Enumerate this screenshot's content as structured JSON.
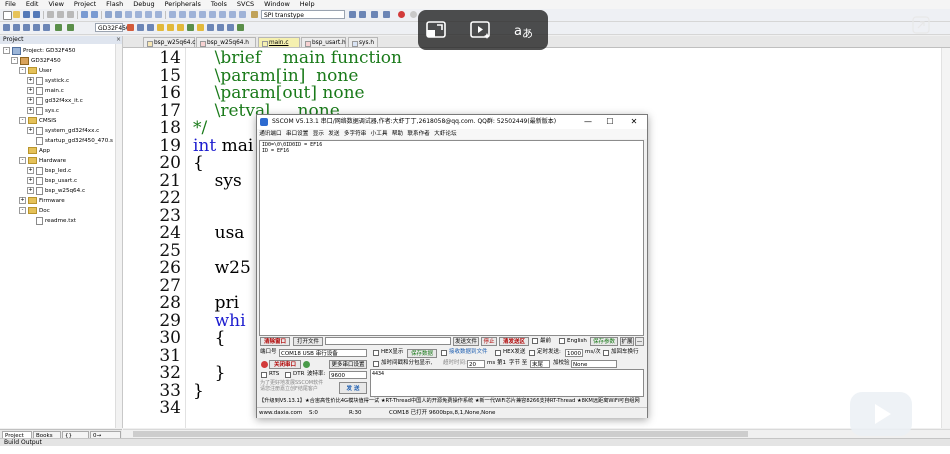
{
  "menubar": [
    "File",
    "Edit",
    "View",
    "Project",
    "Flash",
    "Debug",
    "Peripherals",
    "Tools",
    "SVCS",
    "Window",
    "Help"
  ],
  "toolbar": {
    "device_combo": "SPI transtype",
    "target_combo": "GD32F450"
  },
  "project_panel": {
    "header": "Project",
    "tree": [
      {
        "level": 0,
        "kind": "project",
        "label": "Project: GD32F450",
        "exp": "-"
      },
      {
        "level": 1,
        "kind": "target",
        "label": "GD32F450",
        "exp": "-"
      },
      {
        "level": 2,
        "kind": "folder",
        "label": "User",
        "exp": "-"
      },
      {
        "level": 3,
        "kind": "file",
        "label": "systick.c",
        "exp": "+"
      },
      {
        "level": 3,
        "kind": "file",
        "label": "main.c",
        "exp": "+"
      },
      {
        "level": 3,
        "kind": "file",
        "label": "gd32f4xx_it.c",
        "exp": "+"
      },
      {
        "level": 3,
        "kind": "file",
        "label": "sys.c",
        "exp": "+"
      },
      {
        "level": 2,
        "kind": "folder",
        "label": "CMSIS",
        "exp": "-"
      },
      {
        "level": 3,
        "kind": "file",
        "label": "system_gd32f4xx.c",
        "exp": "+"
      },
      {
        "level": 3,
        "kind": "file",
        "label": "startup_gd32f450_470.s",
        "exp": ""
      },
      {
        "level": 2,
        "kind": "folder",
        "label": "App",
        "exp": ""
      },
      {
        "level": 2,
        "kind": "folder",
        "label": "Hardware",
        "exp": "-"
      },
      {
        "level": 3,
        "kind": "file",
        "label": "bsp_led.c",
        "exp": "+"
      },
      {
        "level": 3,
        "kind": "file",
        "label": "bsp_usart.c",
        "exp": "+"
      },
      {
        "level": 3,
        "kind": "file",
        "label": "bsp_w25q64.c",
        "exp": "+"
      },
      {
        "level": 2,
        "kind": "folder",
        "label": "Firmware",
        "exp": "+"
      },
      {
        "level": 2,
        "kind": "folder",
        "label": "Doc",
        "exp": "-"
      },
      {
        "level": 3,
        "kind": "file",
        "label": "readme.txt",
        "exp": ""
      }
    ],
    "tabs": [
      "Project",
      "Books",
      "{} Func...",
      "0→ Temp..."
    ]
  },
  "file_tabs": [
    {
      "label": "bsp_w25q64.c",
      "color": "#f7e7b5",
      "active": false
    },
    {
      "label": "bsp_w25q64.h",
      "color": "#f7d2d2",
      "active": false
    },
    {
      "label": "main.c",
      "color": "#f5f0b0",
      "active": true
    },
    {
      "label": "bsp_usart.h",
      "color": "#f7d2d2",
      "active": false
    },
    {
      "label": "sys.h",
      "color": "#d9e4f5",
      "active": false
    }
  ],
  "editor": {
    "lines": [
      {
        "n": "14",
        "text": "    \\brief    main function",
        "cls": "cm"
      },
      {
        "n": "15",
        "text": "    \\param[in]  none",
        "cls": "cm"
      },
      {
        "n": "16",
        "text": "    \\param[out] none",
        "cls": "cm"
      },
      {
        "n": "17",
        "text": "    \\retval     none",
        "cls": "cm"
      },
      {
        "n": "18",
        "text": "*/",
        "cls": "cm"
      },
      {
        "n": "19",
        "text": "int mai",
        "cls": "kwstart"
      },
      {
        "n": "20",
        "text": "{",
        "cls": ""
      },
      {
        "n": "21",
        "text": "    sys",
        "cls": ""
      },
      {
        "n": "22",
        "text": "",
        "cls": ""
      },
      {
        "n": "23",
        "text": "",
        "cls": ""
      },
      {
        "n": "24",
        "text": "    usa",
        "cls": ""
      },
      {
        "n": "25",
        "text": "",
        "cls": ""
      },
      {
        "n": "26",
        "text": "    w25",
        "cls": ""
      },
      {
        "n": "27",
        "text": "",
        "cls": ""
      },
      {
        "n": "28",
        "text": "    pri",
        "cls": ""
      },
      {
        "n": "29",
        "text": "    whi",
        "cls": "kw"
      },
      {
        "n": "30",
        "text": "    {",
        "cls": ""
      },
      {
        "n": "31",
        "text": "",
        "cls": ""
      },
      {
        "n": "32",
        "text": "    }",
        "cls": ""
      },
      {
        "n": "33",
        "text": "}",
        "cls": ""
      },
      {
        "n": "34",
        "text": "",
        "cls": ""
      }
    ]
  },
  "build_output": "Build Output",
  "sscom": {
    "title": "SSCOM V5.13.1 串口/网络数据调试器,作者:大虾丁丁,2618058@qq.com. QQ群: 52502449(最新版本)",
    "menu": [
      "通讯端口",
      "串口设置",
      "显示",
      "发送",
      "多字符串",
      "小工具",
      "帮助",
      "联系作者",
      "大虾论坛"
    ],
    "recv_lines": [
      "ID0=\\0\\0ID0ID = EF16",
      "ID = EF16"
    ],
    "row1": {
      "clear": "清除窗口",
      "open_file": "打开文件",
      "send_file": "发送文件",
      "stop": "停止",
      "clear_send": "清发送区",
      "latest": "最前",
      "english": "English",
      "save_params": "保存参数",
      "expand": "扩展",
      "collapse": "—"
    },
    "port_label": "端口号",
    "port_value": "COM18 USB 串行设备",
    "hex_display": "HEX显示",
    "save_data": "保存数据",
    "recv_to_file": "接收数据到文件",
    "hex_send": "HEX发送",
    "timed_send": "定时发送:",
    "interval": "1000",
    "interval_unit": "ms/次",
    "add_return": "加回车换行",
    "close_port": "关闭串口",
    "more_settings": "更多串口设置",
    "timestamp": "加时间戳和分包显示,",
    "timeout_label": "超时时间:",
    "timeout": "20",
    "timeout_unit": "ms",
    "byte_no": "第1",
    "byte_label": "字节 至",
    "end": "末尾",
    "checksum": "加校验",
    "checksum_value": "None",
    "rts": "RTS",
    "dtr": "DTR",
    "baud_label": "波特率:",
    "baud": "9600",
    "send_button": "发 送",
    "note1": "为了更好地发展SSCOM软件",
    "note2": "请您注册嘉立创F结尾客户",
    "send_text": "4434",
    "ticker": "【升级到V5.13.1】★合宙高性价比4G模块值得一试 ★RT-Thread中国人的开源免费操作系统 ★新一代WiFi芯片兼容8266支持RT-Thread ★8KM远距离WiFi可自组网",
    "status": {
      "site": "www.daxia.com",
      "s": "S:0",
      "r": "R:30",
      "port": "COM18 已打开  9600bps,8,1,None,None"
    }
  }
}
